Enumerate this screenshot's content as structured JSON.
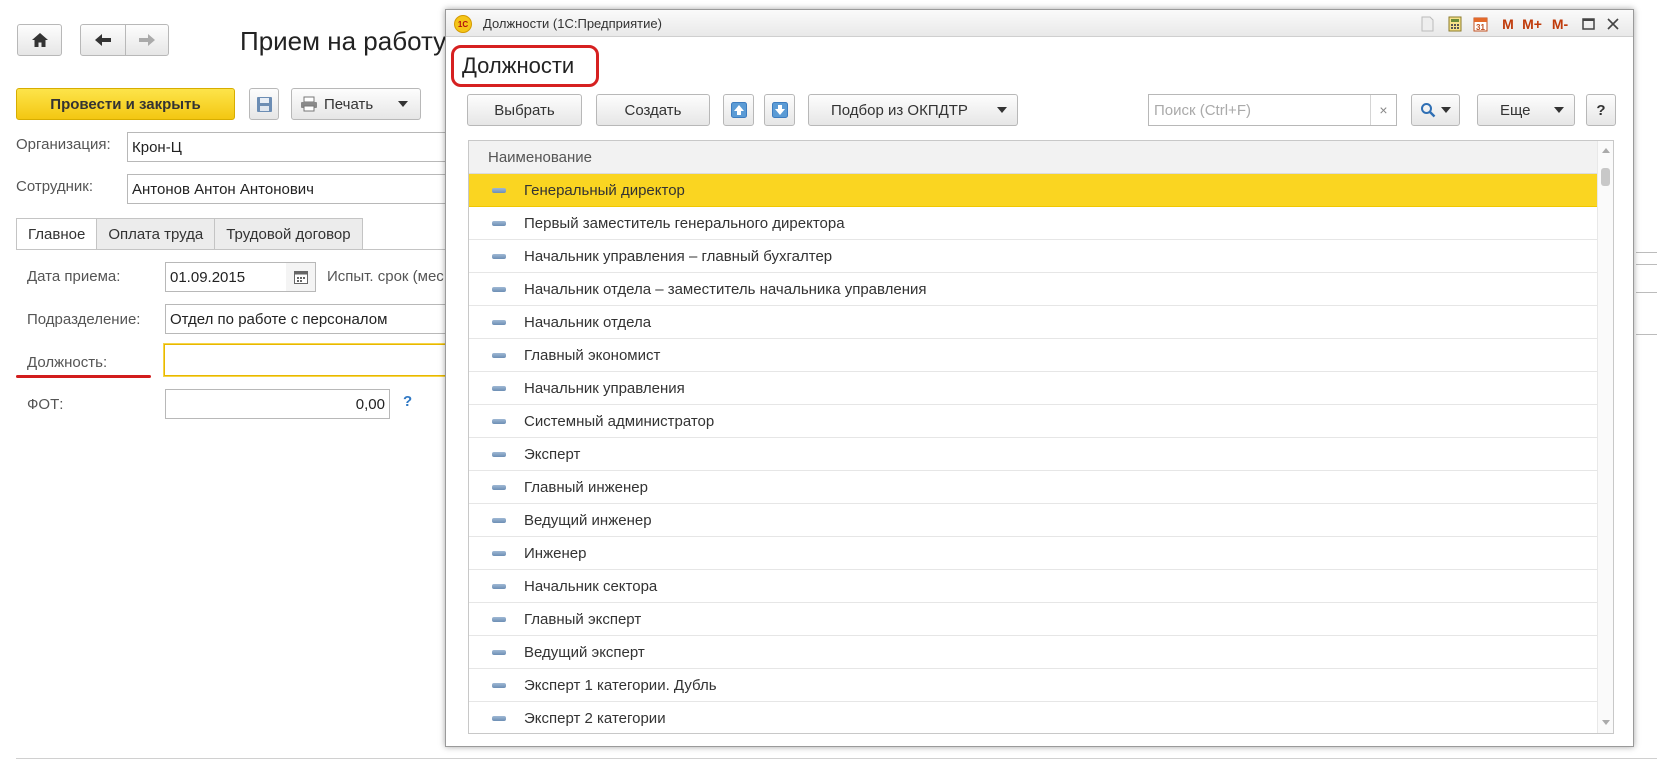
{
  "background_form": {
    "title": "Прием на работу",
    "nav": {
      "home": "home-icon",
      "back": "arrow-left-icon",
      "forward": "arrow-right-icon"
    },
    "toolbar": {
      "post_and_close": "Провести и закрыть",
      "save_icon": "floppy-disk-icon",
      "print": "Печать"
    },
    "fields": {
      "organization_label": "Организация:",
      "organization_value": "Крон-Ц",
      "employee_label": "Сотрудник:",
      "employee_value": "Антонов Антон Антонович"
    },
    "tabs": [
      "Главное",
      "Оплата труда",
      "Трудовой договор"
    ],
    "main_tab": {
      "hire_date_label": "Дата приема:",
      "hire_date_value": "01.09.2015",
      "probation_label": "Испыт. срок (мес",
      "department_label": "Подразделение:",
      "department_value": "Отдел по работе с персоналом",
      "position_label": "Должность:",
      "position_value": "",
      "fot_label": "ФОТ:",
      "fot_value": "0,00",
      "help": "?"
    }
  },
  "modal": {
    "window_title": "Должности (1С:Предприятие)",
    "logo_text": "1С",
    "header": "Должности",
    "titlebar_icons": [
      "document-icon",
      "calculator-icon",
      "calendar-icon",
      "M",
      "M+",
      "M-",
      "maximize-icon",
      "close-icon"
    ],
    "toolbar": {
      "select": "Выбрать",
      "create": "Создать",
      "move_up": "arrow-up-icon",
      "move_down": "arrow-down-icon",
      "okpdtr": "Подбор из ОКПДТР",
      "search_placeholder": "Поиск (Ctrl+F)",
      "search_clear": "×",
      "more": "Еще",
      "help": "?"
    },
    "table": {
      "column_header": "Наименование",
      "selected_index": 0,
      "rows": [
        "Генеральный директор",
        "Первый заместитель генерального директора",
        "Начальник управления – главный бухгалтер",
        "Начальник отдела – заместитель начальника управления",
        "Начальник отдела",
        "Главный экономист",
        "Начальник управления",
        "Системный администратор",
        "Эксперт",
        "Главный инженер",
        "Ведущий инженер",
        "Инженер",
        "Начальник сектора",
        "Главный эксперт",
        "Ведущий эксперт",
        "Эксперт 1 категории. Дубль",
        "Эксперт 2 категории"
      ]
    }
  },
  "colors": {
    "accent_yellow": "#fad521",
    "primary_button": "#f3c712",
    "highlight_red": "#d62020",
    "help_blue": "#2f78c4"
  }
}
